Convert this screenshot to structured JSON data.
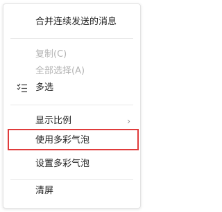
{
  "menu": {
    "merge_forward": "合并连续发送的消息",
    "copy": "复制(C)",
    "select_all": "全部选择(A)",
    "multi_select": "多选",
    "display_ratio": "显示比例",
    "use_colorful_bubbles": "使用多彩气泡",
    "set_colorful_bubbles": "设置多彩气泡",
    "clear_screen": "清屏"
  },
  "icons": {
    "multi_select": "list-check-icon",
    "submenu": "chevron-right-icon"
  },
  "colors": {
    "highlight_border": "#e03b3b",
    "disabled_text": "#b4b4b4"
  }
}
